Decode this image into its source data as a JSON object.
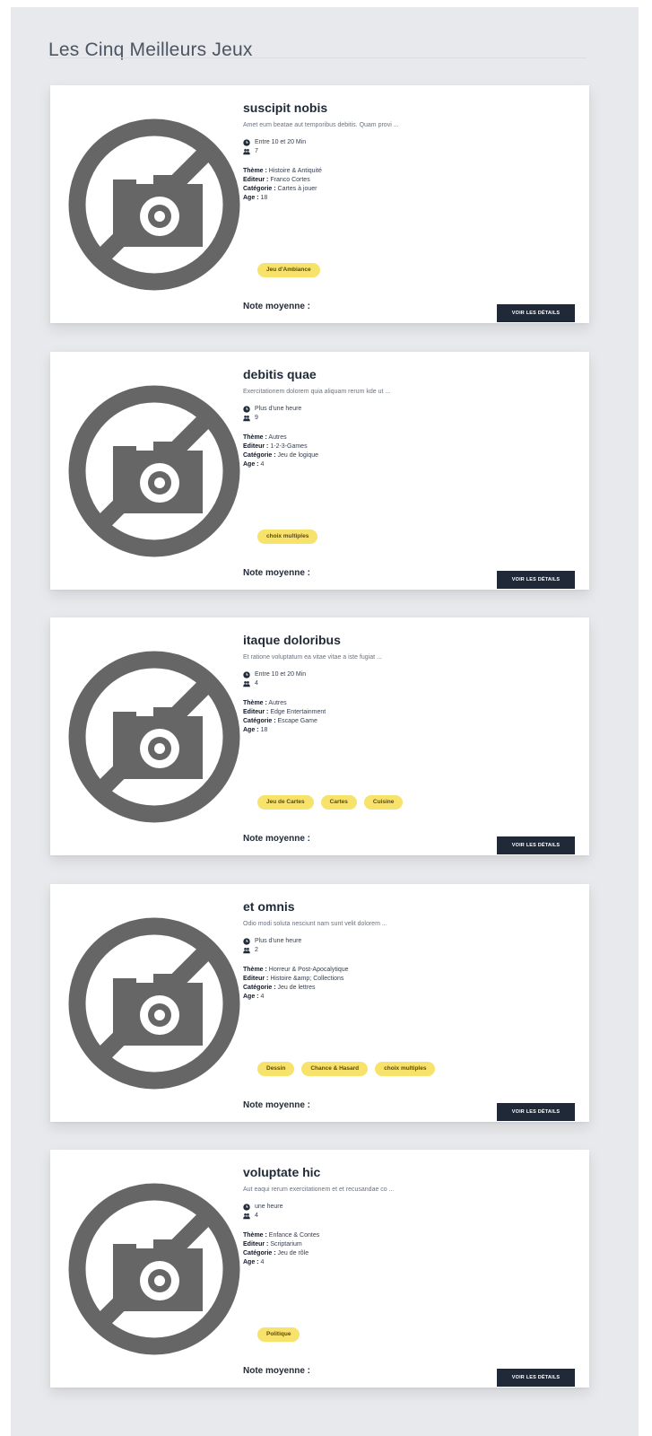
{
  "page": {
    "title": "Les Cinq Meilleurs Jeux"
  },
  "labels": {
    "theme": "Thème :",
    "editor": "Editeur :",
    "category": "Catégorie :",
    "age": "Age :",
    "rating": "Note moyenne :",
    "details_button": "VOIR LES DÉTAILS"
  },
  "icons": {
    "time": "clock-icon",
    "players": "players-icon",
    "image_placeholder": "no-photo-icon"
  },
  "colors": {
    "tag_bg": "#f7e26b",
    "button_bg": "#1f2937",
    "placeholder_gray": "#666666"
  },
  "games": [
    {
      "title": "suscipit nobis",
      "description": "Amet eum beatae aut temporibus debitis. Quam provi ...",
      "duration": "Entre 10 et 20 Min",
      "players": "7",
      "theme": "Histoire & Antiquité",
      "editor": "Franco Cortes",
      "category": "Cartes à jouer",
      "age": "18",
      "tags": [
        "Jeu d'Ambiance"
      ]
    },
    {
      "title": "debitis quae",
      "description": "Exercitationem dolorem quia aliquam rerum kde ut ...",
      "duration": "Plus d'une heure",
      "players": "9",
      "theme": "Autres",
      "editor": "1-2-3-Games",
      "category": "Jeu de logique",
      "age": "4",
      "tags": [
        "choix multiples"
      ]
    },
    {
      "title": "itaque doloribus",
      "description": "Et ratione voluptatum ea vitae vitae a iste fugiat ...",
      "duration": "Entre 10 et 20 Min",
      "players": "4",
      "theme": "Autres",
      "editor": "Edge Entertainment",
      "category": "Escape Game",
      "age": "18",
      "tags": [
        "Jeu de Cartes",
        "Cartes",
        "Cuisine"
      ]
    },
    {
      "title": "et omnis",
      "description": "Odio modi soluta nesciunt nam sunt velit dolorem ...",
      "duration": "Plus d'une heure",
      "players": "2",
      "theme": "Horreur & Post-Apocalytique",
      "editor": "Histoire &amp; Collections",
      "category": "Jeu de lettres",
      "age": "4",
      "tags": [
        "Dessin",
        "Chance & Hasard",
        "choix multiples"
      ]
    },
    {
      "title": "voluptate hic",
      "description": "Aut eaqui rerum exercitationem et et recusandae co ...",
      "duration": "une heure",
      "players": "4",
      "theme": "Enfance & Contes",
      "editor": "Scriptarium",
      "category": "Jeu de rôle",
      "age": "4",
      "tags": [
        "Politique"
      ]
    }
  ]
}
